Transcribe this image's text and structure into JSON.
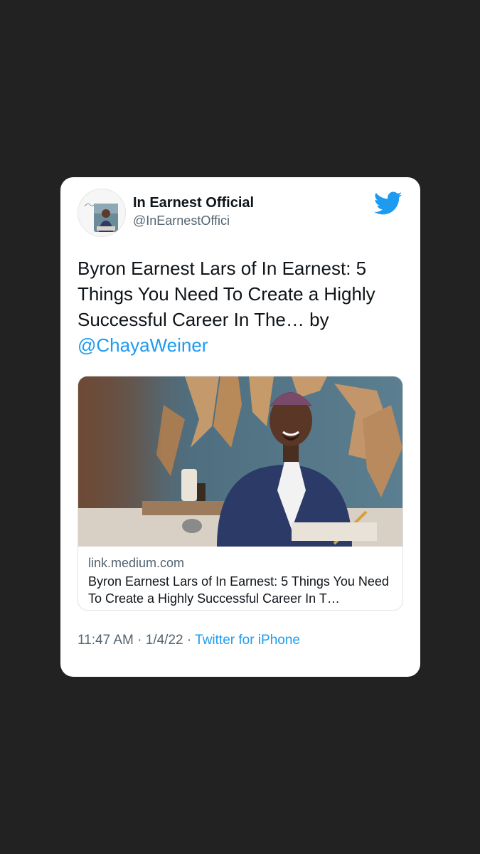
{
  "tweet": {
    "author": {
      "name": "In Earnest Official",
      "handle": "@InEarnestOffici",
      "avatar_icon": "profile-photo"
    },
    "brand_icon": "twitter-bird-icon",
    "brand_color": "#1d9bf0",
    "text_main": "Byron Earnest Lars of In Earnest: 5 Things You Need To Create a Highly Successful Career In The… by",
    "mention": "@ChayaWeiner",
    "link_card": {
      "domain": "link.medium.com",
      "title": "Byron Earnest Lars of In Earnest: 5 Things You Need To Create a Highly Successful Career In T…"
    },
    "time": "11:47 AM",
    "separator": "·",
    "date": "1/4/22",
    "source": "Twitter for iPhone"
  }
}
